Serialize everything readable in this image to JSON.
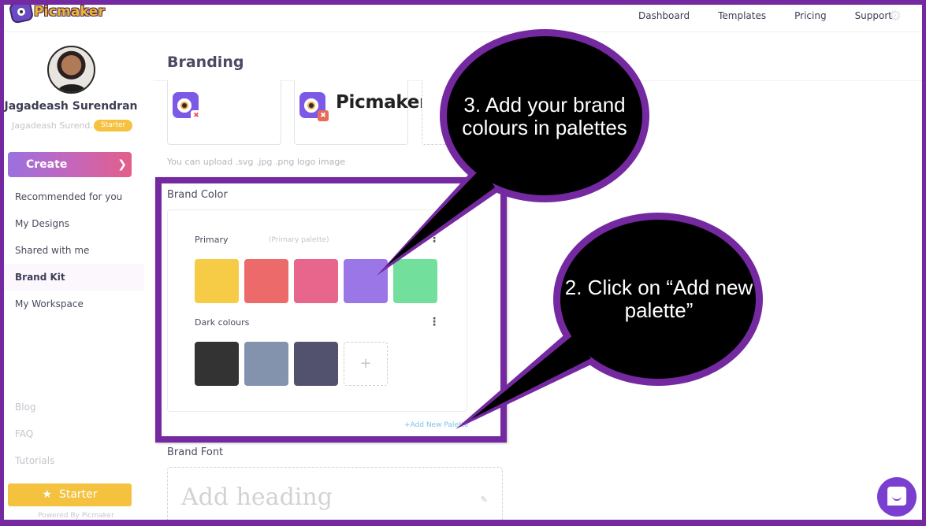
{
  "app": {
    "logo_text": "Picmaker"
  },
  "nav": {
    "items": [
      "Dashboard",
      "Templates",
      "Pricing",
      "Support"
    ],
    "settings_icon": "gear-icon"
  },
  "user": {
    "name": "Jagadeash Surendran",
    "sub_name": "Jagadeash Surend...",
    "plan_badge": "Starter"
  },
  "sidebar": {
    "create_label": "Create",
    "items": [
      {
        "label": "Recommended for you",
        "active": false
      },
      {
        "label": "My Designs",
        "active": false
      },
      {
        "label": "Shared with me",
        "active": false
      },
      {
        "label": "Brand Kit",
        "active": true
      },
      {
        "label": "My Workspace",
        "active": false
      }
    ],
    "secondary_items": [
      "Blog",
      "FAQ",
      "Tutorials"
    ],
    "upgrade_label": "Starter",
    "powered_by": "Powered By Picmaker"
  },
  "main": {
    "title": "Branding",
    "logo_wordmark": "Picmaker",
    "upload_hint": "You can upload .svg .jpg .png logo image",
    "brand_color": {
      "label": "Brand Color",
      "palettes": [
        {
          "name": "Primary",
          "subtitle": "(Primary palette)",
          "colors": [
            "#f6cb45",
            "#ec6a6a",
            "#e8658c",
            "#9b76e6",
            "#72e09c"
          ]
        },
        {
          "name": "Dark colours",
          "subtitle": "",
          "colors": [
            "#333333",
            "#8393ad",
            "#52526e"
          ]
        }
      ],
      "add_swatch_glyph": "+",
      "add_palette_label": "+Add New Palette"
    },
    "brand_font": {
      "label": "Brand Font",
      "placeholder": "Add heading"
    }
  },
  "annotations": {
    "callout_3": "3. Add your brand colours in palettes",
    "callout_2": "2.  Click on “Add new palette”",
    "accent_color": "#7429a0"
  }
}
